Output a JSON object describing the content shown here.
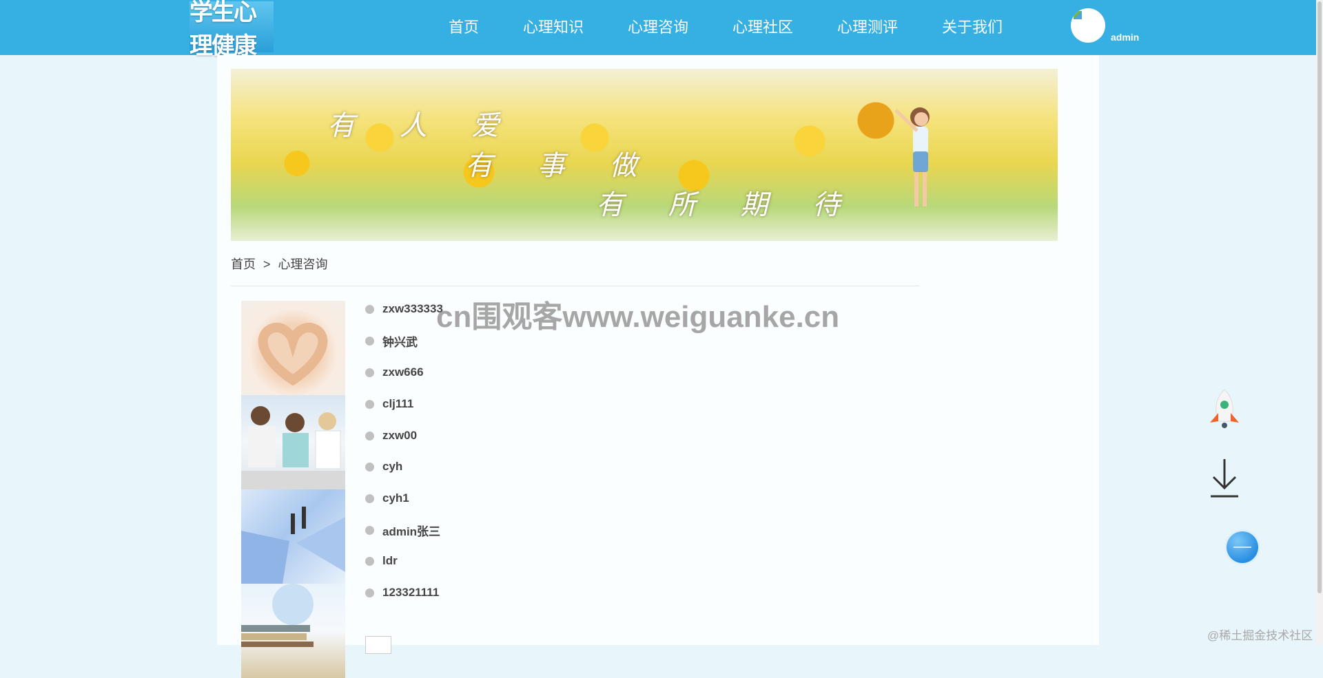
{
  "header": {
    "logo_text": "学生心理健康",
    "nav": [
      "首页",
      "心理知识",
      "心理咨询",
      "心理社区",
      "心理测评",
      "关于我们"
    ],
    "username": "admin"
  },
  "banner": {
    "lines": [
      "有 人 爱",
      "有 事 做",
      "有 所 期 待"
    ]
  },
  "breadcrumb": {
    "home": "首页",
    "separator": ">",
    "current": "心理咨询"
  },
  "counselors": [
    "zxw333333",
    "钟兴武",
    "zxw666",
    "clj111",
    "zxw00",
    "cyh",
    "cyh1",
    "admin张三",
    "ldr",
    "123321111"
  ],
  "overlay_watermark": "cn围观客www.weiguanke.cn",
  "source_credit": "@稀土掘金技术社区",
  "side_tools": {
    "rocket_icon": "rocket-icon",
    "download_icon": "download-icon",
    "round_icon": "blue-circle-icon"
  }
}
